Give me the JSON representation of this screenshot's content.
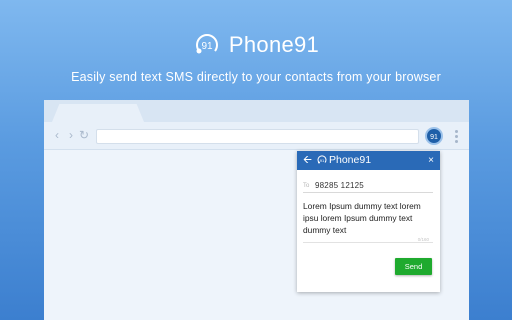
{
  "brand": {
    "name": "Phone91",
    "logo_icon": "phone91-logo-icon"
  },
  "tagline": "Easily send text SMS directly to your contacts from your browser",
  "browser": {
    "nav": {
      "back": "‹",
      "forward": "›",
      "reload": "↻"
    },
    "extension_icon": "phone91-extension-icon"
  },
  "popup": {
    "title": "Phone91",
    "back_icon": "back-arrow-icon",
    "close": "×",
    "to_label": "To",
    "to_value": "98285 12125",
    "message": "Lorem Ipsum dummy text lorem ipsu lorem Ipsum dummy text dummy text",
    "char_count": "0/160",
    "send_label": "Send"
  },
  "colors": {
    "header": "#2a6ab7",
    "send": "#1faa2e",
    "background": "#5a9be0"
  }
}
